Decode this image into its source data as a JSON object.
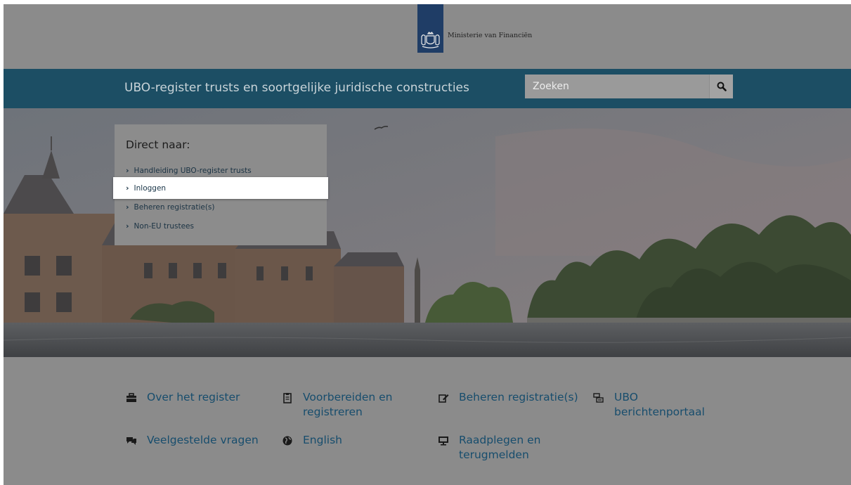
{
  "header": {
    "ministry_name": "Ministerie van Financiën"
  },
  "titlebar": {
    "site_title": "UBO-register trusts en soortgelijke juridische constructies",
    "search_placeholder": "Zoeken"
  },
  "direct": {
    "title": "Direct naar:",
    "items": [
      {
        "label": "Handleiding UBO-register trusts"
      },
      {
        "label": "Inloggen"
      },
      {
        "label": "Beheren registratie(s)"
      },
      {
        "label": "Non-EU trustees"
      }
    ]
  },
  "nav": {
    "items": [
      {
        "label": "Over het register",
        "icon": "briefcase-icon"
      },
      {
        "label": "Voorbereiden en registreren",
        "icon": "clipboard-icon"
      },
      {
        "label": "Beheren registratie(s)",
        "icon": "edit-icon"
      },
      {
        "label": "UBO berichtenportaal",
        "icon": "messages-icon"
      },
      {
        "label": "Veelgestelde vragen",
        "icon": "chat-icon"
      },
      {
        "label": "English",
        "icon": "globe-icon"
      },
      {
        "label": "Raadplegen en terugmelden",
        "icon": "monitor-icon"
      }
    ]
  },
  "colors": {
    "title_bar": "#1c4e64",
    "logo_band": "#1f3d66",
    "link": "#174d6d",
    "overlay_gray": "#8b8b8b"
  }
}
